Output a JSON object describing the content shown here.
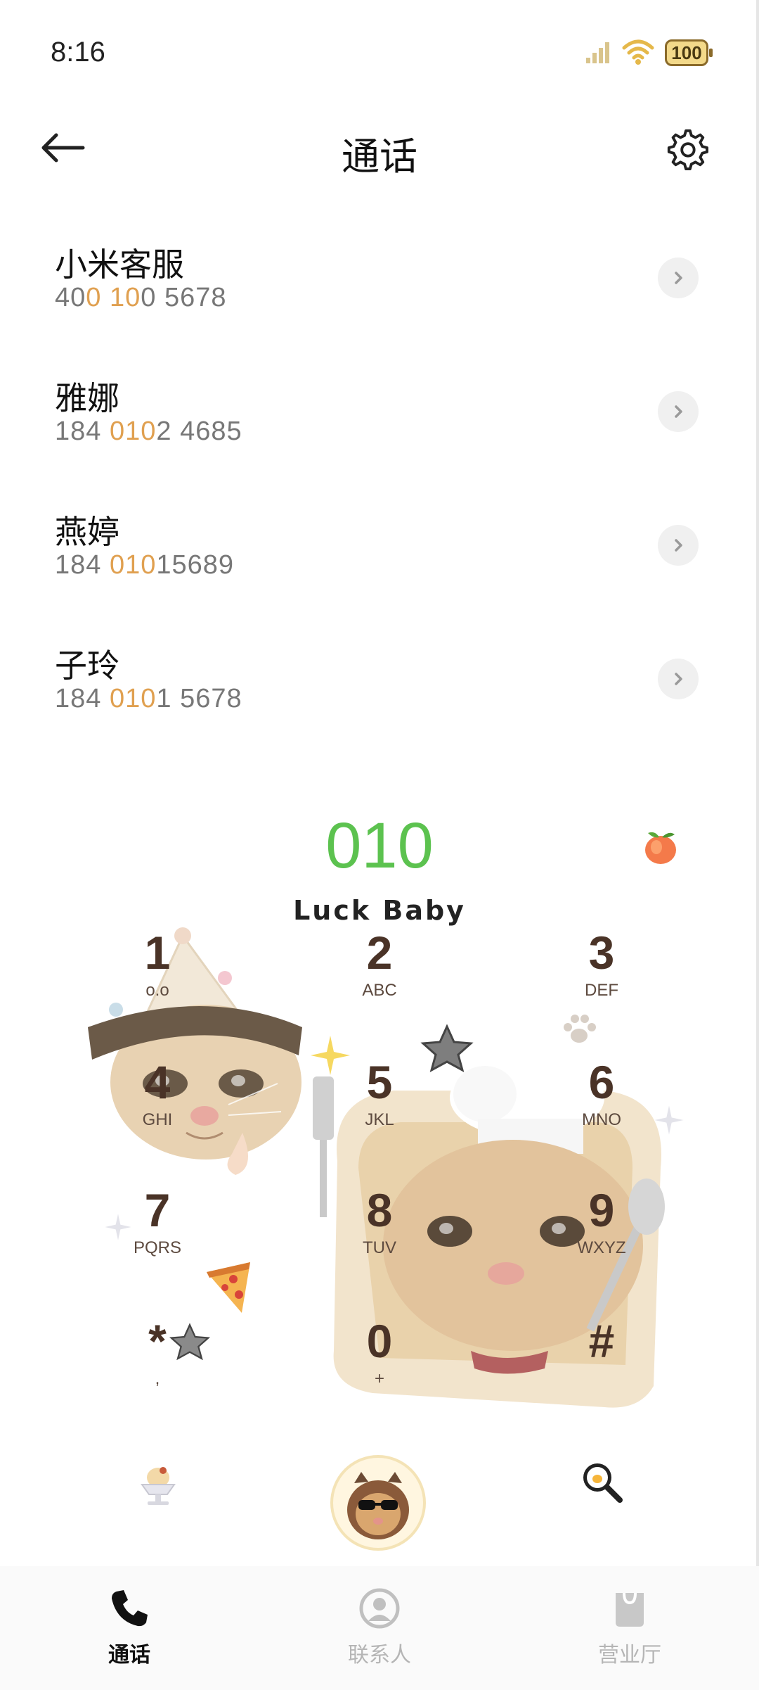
{
  "status_bar": {
    "time": "8:16",
    "battery": "100"
  },
  "header": {
    "title": "通话"
  },
  "calls": [
    {
      "name": "小米客服",
      "number_parts": [
        "40",
        "0",
        " ",
        "10",
        "0 5678"
      ]
    },
    {
      "name": "雅娜",
      "number_parts": [
        "184 ",
        "010",
        "2 4685"
      ]
    },
    {
      "name": "燕婷",
      "number_parts": [
        "184 ",
        "010",
        "15689"
      ]
    },
    {
      "name": "子玲",
      "number_parts": [
        "184 ",
        "010",
        "1 5678"
      ]
    }
  ],
  "dialer": {
    "input": "010",
    "theme_text": "Luck Baby",
    "keys": [
      {
        "digit": "1",
        "letters": "o.o"
      },
      {
        "digit": "2",
        "letters": "ABC"
      },
      {
        "digit": "3",
        "letters": "DEF"
      },
      {
        "digit": "4",
        "letters": "GHI"
      },
      {
        "digit": "5",
        "letters": "JKL"
      },
      {
        "digit": "6",
        "letters": "MNO"
      },
      {
        "digit": "7",
        "letters": "PQRS"
      },
      {
        "digit": "8",
        "letters": "TUV"
      },
      {
        "digit": "9",
        "letters": "WXYZ"
      },
      {
        "digit": "*",
        "letters": ","
      },
      {
        "digit": "0",
        "letters": "+"
      },
      {
        "digit": "#",
        "letters": ""
      }
    ]
  },
  "bottom_nav": {
    "items": [
      {
        "label": "通话",
        "active": true
      },
      {
        "label": "联系人",
        "active": false
      },
      {
        "label": "营业厅",
        "active": false
      }
    ]
  },
  "colors": {
    "accent_green": "#5cc24f",
    "highlight_orange": "#e0a050",
    "key_brown": "#4a3327"
  }
}
